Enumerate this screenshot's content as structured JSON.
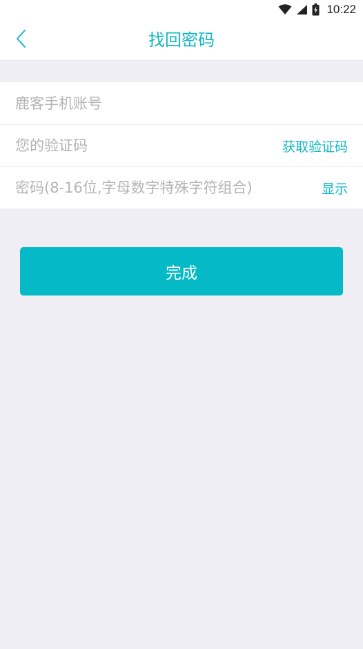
{
  "status_bar": {
    "time": "10:22",
    "icons": [
      "wifi-icon",
      "cellular-signal-icon",
      "battery-charging-icon"
    ]
  },
  "header": {
    "back_icon": "chevron-left-icon",
    "title": "找回密码"
  },
  "form": {
    "account": {
      "placeholder": "鹿客手机账号",
      "value": ""
    },
    "verification_code": {
      "placeholder": "您的验证码",
      "value": "",
      "action_label": "获取验证码"
    },
    "password": {
      "placeholder": "密码(8-16位,字母数字特殊字符组合)",
      "value": "",
      "action_label": "显示"
    }
  },
  "submit": {
    "label": "完成"
  },
  "colors": {
    "accent": "#12B7C6",
    "button": "#05BAC6",
    "background": "#EEEEF4",
    "placeholder": "#B4B4B4"
  }
}
